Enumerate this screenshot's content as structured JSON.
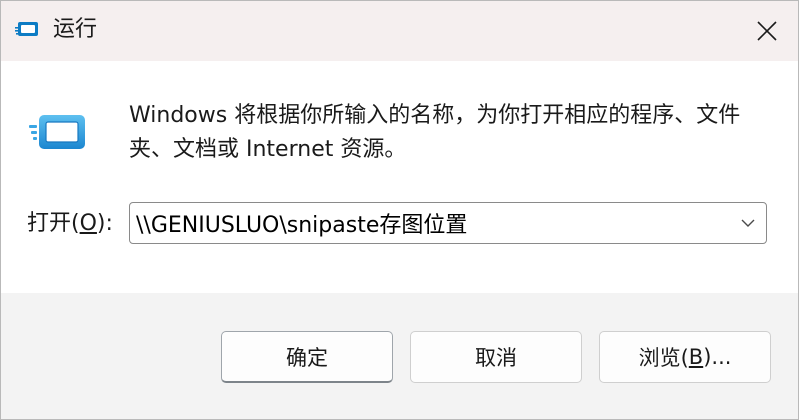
{
  "window": {
    "title": "运行",
    "close_icon": "close-icon",
    "title_icon": "run-app-icon"
  },
  "main": {
    "icon": "run-app-icon",
    "message": "Windows 将根据你所输入的名称，为你打开相应的程序、文件夹、文档或 Internet 资源。",
    "open_label_prefix": "打开(",
    "open_label_access": "O",
    "open_label_suffix": "):",
    "input_value": "\\\\GENIUSLUO\\snipaste存图位置",
    "dropdown_icon": "chevron-down-icon"
  },
  "buttons": {
    "ok": "确定",
    "cancel": "取消",
    "browse_prefix": "浏览(",
    "browse_access": "B",
    "browse_suffix": ")..."
  },
  "colors": {
    "titlebar_bg": "#f5efef",
    "content_bg": "#ffffff",
    "footer_bg": "#f3f3f3",
    "icon_blue": "#1e8fd6"
  }
}
